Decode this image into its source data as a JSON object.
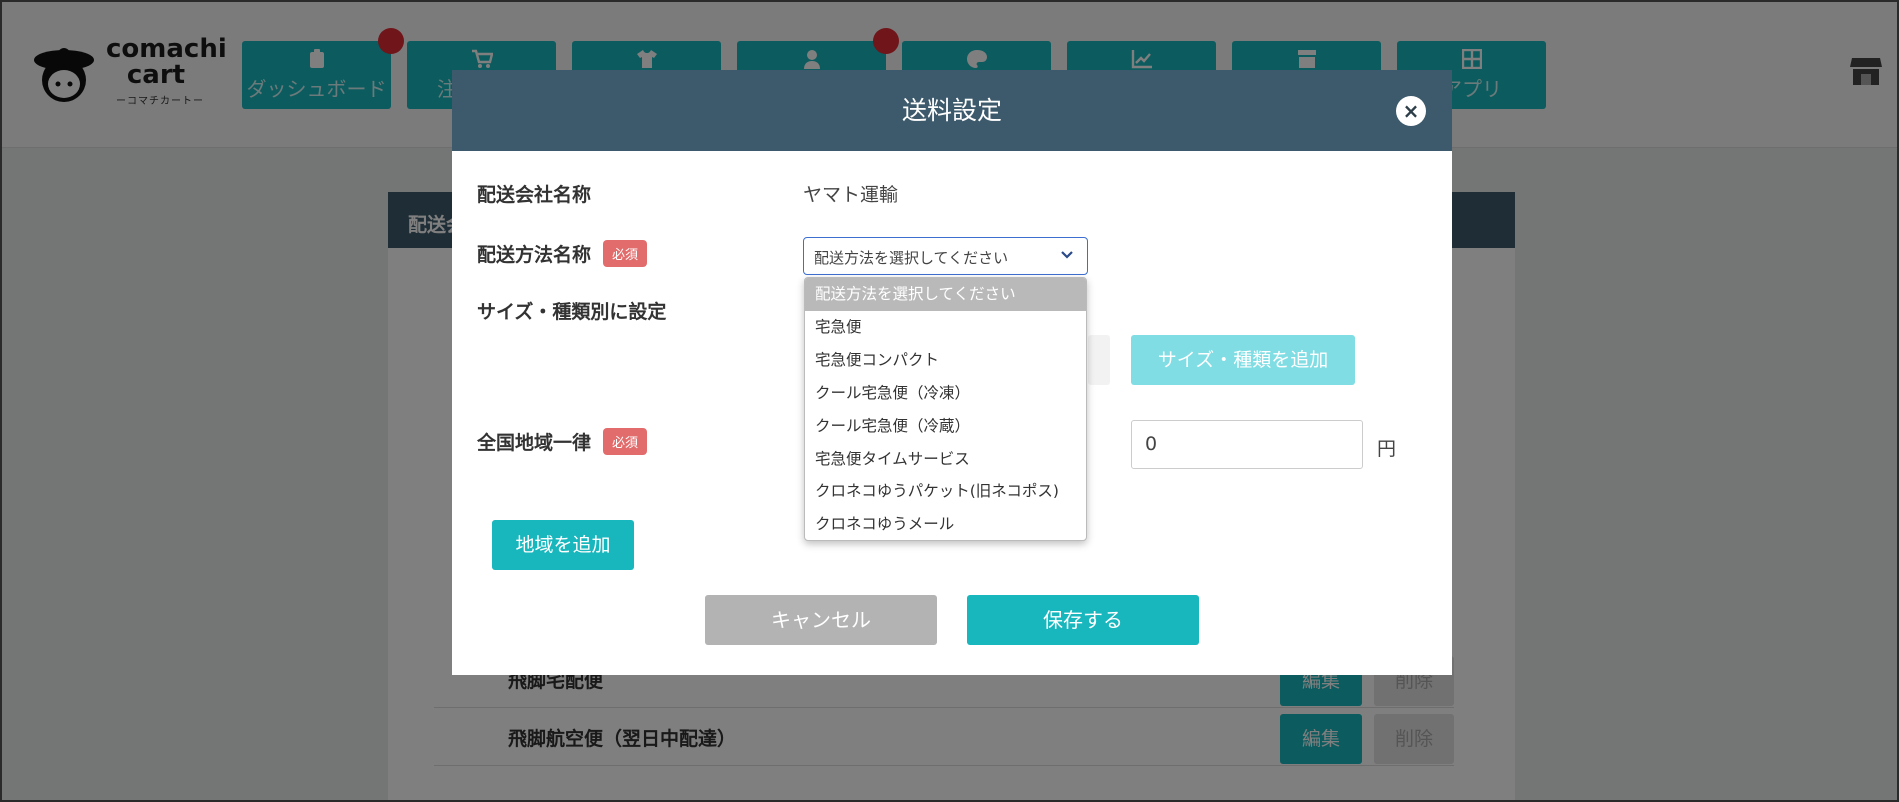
{
  "app": {
    "logo_word_top": "comachi",
    "logo_word_bottom": "cart",
    "logo_sub": "ーコマチカートー"
  },
  "nav": [
    {
      "label": "ダッシュボード",
      "icon": "clipboard-icon"
    },
    {
      "label": "注",
      "icon": "cart-icon"
    },
    {
      "label": "",
      "icon": "shirt-icon"
    },
    {
      "label": "",
      "icon": "user-icon"
    },
    {
      "label": "",
      "icon": "palette-icon"
    },
    {
      "label": "",
      "icon": "chart-icon"
    },
    {
      "label": "",
      "icon": "store-icon"
    },
    {
      "label": "アプリ",
      "icon": "grid-icon"
    }
  ],
  "background": {
    "panel_head": "配送会",
    "rows": [
      {
        "name": "飛脚宅配便",
        "edit": "編集",
        "delete": "削除"
      },
      {
        "name": "飛脚航空便（翌日中配達）",
        "edit": "編集",
        "delete": "削除"
      }
    ]
  },
  "modal": {
    "title": "送料設定",
    "close": "×",
    "carrier_label": "配送会社名称",
    "carrier_value": "ヤマト運輸",
    "method_label": "配送方法名称",
    "required": "必須",
    "size_label": "サイズ・種類別に設定",
    "select_value": "配送方法を選択してください",
    "options": [
      "配送方法を選択してください",
      "宅急便",
      "宅急便コンパクト",
      "クール宅急便（冷凍）",
      "クール宅急便（冷蔵）",
      "宅急便タイムサービス",
      "クロネコゆうパケット(旧ネコポス)",
      "クロネコゆうメール"
    ],
    "add_size_button": "サイズ・種類を追加",
    "nationwide_label": "全国地域一律",
    "price_value": "0",
    "yen": "円",
    "add_region_button": "地域を追加",
    "cancel_button": "キャンセル",
    "save_button": "保存する"
  },
  "colors": {
    "teal": "#18b6bd",
    "header_navy": "#3d5a6c",
    "required_red": "#e26c6c",
    "badge_red": "#e02a35"
  }
}
